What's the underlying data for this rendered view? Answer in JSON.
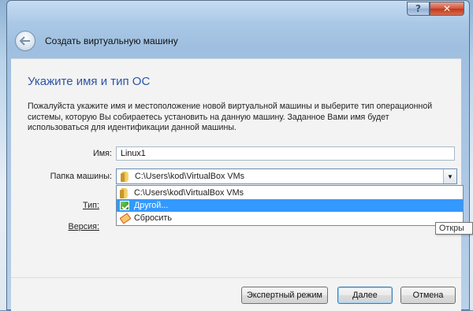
{
  "window": {
    "help_label": "?",
    "close_label": "✕"
  },
  "wizard": {
    "title": "Создать виртуальную машину",
    "back_icon": "back-arrow-icon"
  },
  "page": {
    "heading": "Укажите имя и тип ОС",
    "description": "Пожалуйста укажите имя и местоположение новой виртуальной машины и выберите тип операционной системы, которую Вы собираетесь установить на данную машину. Заданное Вами имя будет использоваться для идентификации данной машины."
  },
  "form": {
    "name_label": "Имя:",
    "name_value": "Linux1",
    "folder_label": "Папка машины:",
    "folder_value": "C:\\Users\\kod\\VirtualBox VMs",
    "type_label": "Тип:",
    "version_label": "Версия:"
  },
  "dropdown": {
    "items": [
      {
        "label": "C:\\Users\\kod\\VirtualBox VMs",
        "icon": "folder-icon"
      },
      {
        "label": "Другой...",
        "icon": "other-icon"
      },
      {
        "label": "Сбросить",
        "icon": "reset-icon"
      }
    ],
    "selected_index": 1
  },
  "tooltip": {
    "text": "Откры"
  },
  "buttons": {
    "expert": "Экспертный режим",
    "next": "Далее",
    "cancel": "Отмена"
  }
}
